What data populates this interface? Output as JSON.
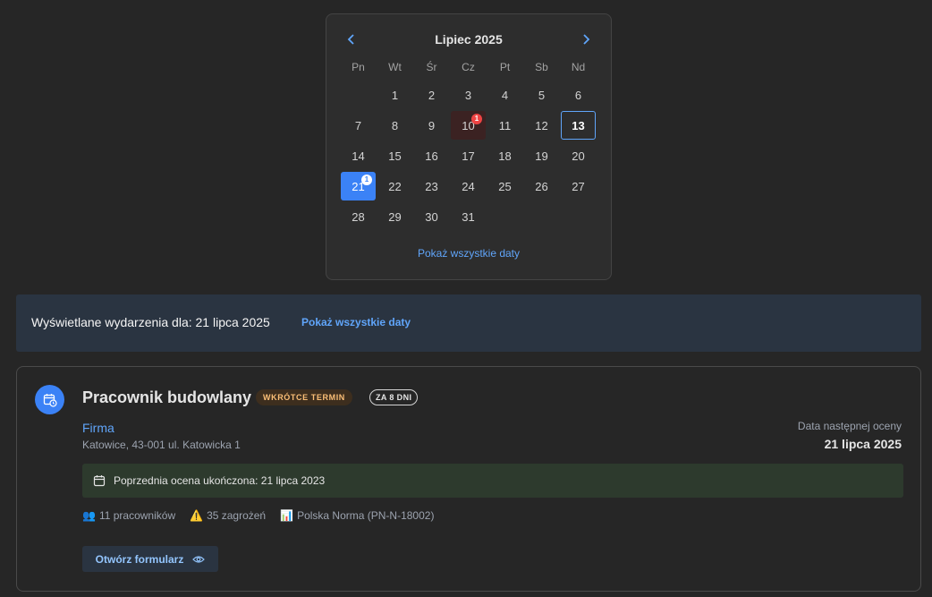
{
  "calendar": {
    "title": "Lipiec 2025",
    "weekdays": [
      "Pn",
      "Wt",
      "Śr",
      "Cz",
      "Pt",
      "Sb",
      "Nd"
    ],
    "days": [
      {
        "label": "",
        "state": "empty"
      },
      {
        "label": "1"
      },
      {
        "label": "2"
      },
      {
        "label": "3"
      },
      {
        "label": "4"
      },
      {
        "label": "5"
      },
      {
        "label": "6"
      },
      {
        "label": "7"
      },
      {
        "label": "8"
      },
      {
        "label": "9"
      },
      {
        "label": "10",
        "state": "event",
        "badge": "1",
        "badge_color": "red"
      },
      {
        "label": "11"
      },
      {
        "label": "12"
      },
      {
        "label": "13",
        "state": "today"
      },
      {
        "label": "14"
      },
      {
        "label": "15"
      },
      {
        "label": "16"
      },
      {
        "label": "17"
      },
      {
        "label": "18"
      },
      {
        "label": "19"
      },
      {
        "label": "20"
      },
      {
        "label": "21",
        "state": "selected",
        "badge": "1",
        "badge_color": "white"
      },
      {
        "label": "22"
      },
      {
        "label": "23"
      },
      {
        "label": "24"
      },
      {
        "label": "25"
      },
      {
        "label": "26"
      },
      {
        "label": "27"
      },
      {
        "label": "28"
      },
      {
        "label": "29"
      },
      {
        "label": "30"
      },
      {
        "label": "31"
      }
    ],
    "footer_link": "Pokaż wszystkie daty"
  },
  "info_bar": {
    "text": "Wyświetlane wydarzenia dla: 21 lipca 2025",
    "link": "Pokaż wszystkie daty"
  },
  "card": {
    "icon": "calendar-clock-icon",
    "title": "Pracownik budowlany",
    "tag_soon": "WKRÓTCE TERMIN",
    "tag_days": "ZA 8 DNI",
    "company": "Firma",
    "address": "Katowice, 43-001 ul. Katowicka 1",
    "next_label": "Data następnej oceny",
    "next_date": "21 lipca 2025",
    "previous": "Poprzednia ocena ukończona: 21 lipca 2023",
    "stats": [
      {
        "icon": "👥",
        "icon_name": "people-icon",
        "text": "11 pracowników"
      },
      {
        "icon": "⚠️",
        "icon_name": "warning-icon",
        "text": "35 zagrożeń"
      },
      {
        "icon": "📊",
        "icon_name": "chart-icon",
        "text": "Polska Norma (PN-N-18002)"
      }
    ],
    "button": "Otwórz formularz"
  },
  "colors": {
    "accent": "#3b82f6",
    "link": "#60a5fa",
    "badge_red": "#ef4444",
    "tag_soon_text": "#fbbf77"
  }
}
